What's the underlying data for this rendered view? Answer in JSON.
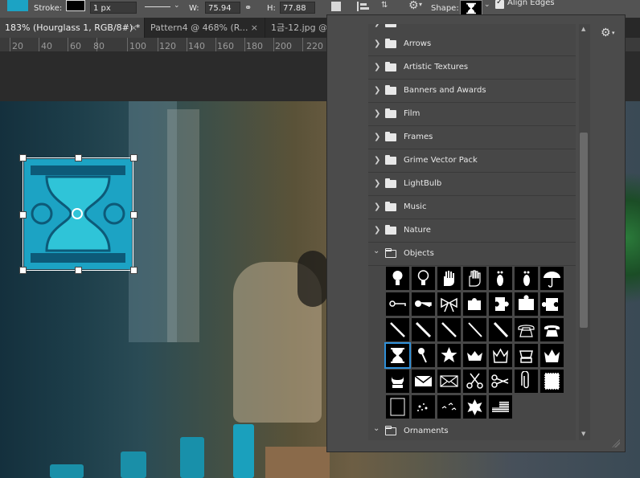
{
  "options_bar": {
    "stroke_label": "Stroke:",
    "stroke_width": "1 px",
    "width_label": "W:",
    "width_value": "75.94 px",
    "height_label": "H:",
    "height_value": "77.88 px",
    "shape_label": "Shape:",
    "align_edges_label": "Align Edges",
    "fill_color": "#1ca3c4"
  },
  "tabs": [
    {
      "label": "183% (Hourglass 1, RGB/8#) *",
      "close": "×"
    },
    {
      "label": "Pattern4 @ 468% (R...",
      "close": "×"
    },
    {
      "label": "1금-12.jpg @",
      "close": ""
    }
  ],
  "ruler": {
    "ticks": [
      "20",
      "40",
      "60",
      "80",
      "100",
      "120",
      "140",
      "160",
      "180",
      "200",
      "220"
    ]
  },
  "shape_picker": {
    "folders": [
      {
        "label": "",
        "open": false
      },
      {
        "label": "Arrows",
        "open": false
      },
      {
        "label": "Artistic Textures",
        "open": false
      },
      {
        "label": "Banners and Awards",
        "open": false
      },
      {
        "label": "Film",
        "open": false
      },
      {
        "label": "Frames",
        "open": false
      },
      {
        "label": "Grime Vector Pack",
        "open": false
      },
      {
        "label": "LightBulb",
        "open": false
      },
      {
        "label": "Music",
        "open": false
      },
      {
        "label": "Nature",
        "open": false
      },
      {
        "label": "Objects",
        "open": true
      }
    ],
    "after_folder": {
      "label": "Ornaments",
      "open": false
    },
    "shapes": [
      "lightbulb-1",
      "lightbulb-2",
      "hand-left",
      "hand-right",
      "footprint-left",
      "footprint-right",
      "umbrella",
      "key-1",
      "key-2",
      "bow",
      "puzzle-1",
      "puzzle-2",
      "puzzle-3",
      "puzzle-4",
      "pencil-1",
      "pencil-2",
      "pencil-3",
      "pencil-4",
      "pencil-5",
      "telephone-1",
      "telephone-2",
      "hourglass",
      "pushpin",
      "star-badge",
      "crown-1",
      "crown-2",
      "crown-3",
      "crown-4",
      "crown-5",
      "envelope-1",
      "envelope-2",
      "scissors-1",
      "scissors-2",
      "paperclip",
      "stamp",
      "frame-black",
      "splatter",
      "birds",
      "fleur",
      "flag"
    ],
    "selected_shape": "hourglass"
  }
}
